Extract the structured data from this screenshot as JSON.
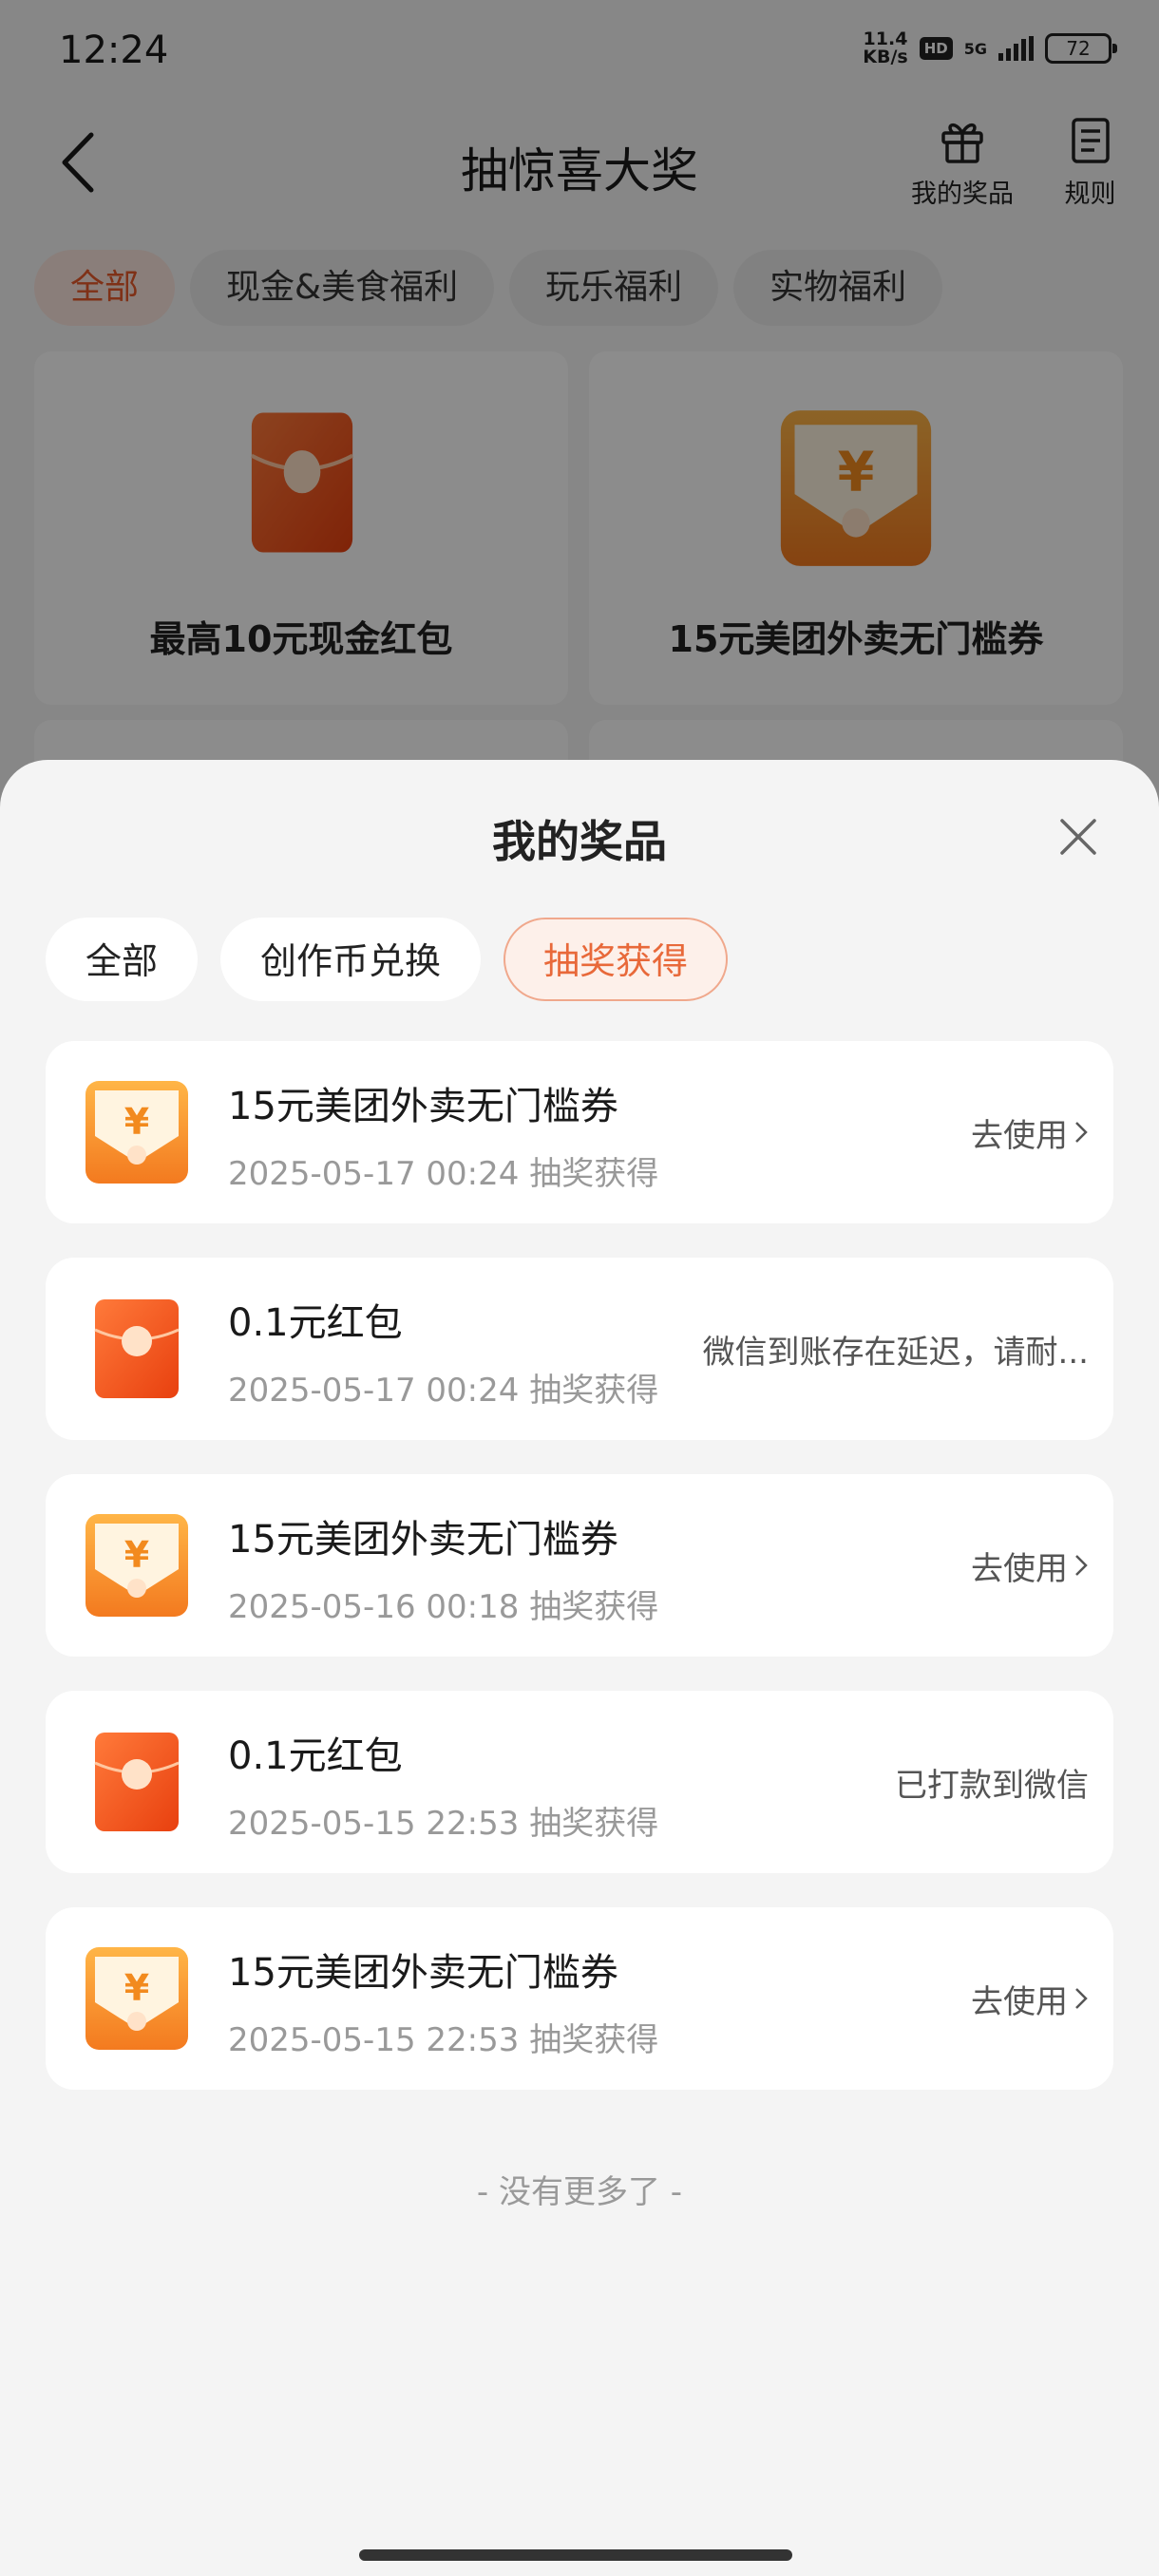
{
  "status_bar": {
    "time": "12:24",
    "net_speed_value": "11.4",
    "net_speed_unit": "KB/s",
    "hd": "HD",
    "signal_label": "5G",
    "battery": "72"
  },
  "header": {
    "title": "抽惊喜大奖",
    "my_prizes_label": "我的奖品",
    "rules_label": "规则"
  },
  "category_tabs": [
    {
      "label": "全部",
      "active": true
    },
    {
      "label": "现金&美食福利",
      "active": false
    },
    {
      "label": "玩乐福利",
      "active": false
    },
    {
      "label": "实物福利",
      "active": false
    }
  ],
  "background_cards": [
    {
      "title": "最高10元现金红包",
      "icon": "red-envelope-icon"
    },
    {
      "title": "15元美团外卖无门槛券",
      "icon": "coupon-envelope-icon"
    }
  ],
  "sheet": {
    "title": "我的奖品",
    "filter_tabs": [
      {
        "label": "全部",
        "active": false
      },
      {
        "label": "创作币兑换",
        "active": false
      },
      {
        "label": "抽奖获得",
        "active": true
      }
    ],
    "items": [
      {
        "name": "15元美团外卖无门槛券",
        "date": "2025-05-17 00:24 抽奖获得",
        "status": "去使用",
        "icon": "coupon-envelope-icon",
        "actionable": true
      },
      {
        "name": "0.1元红包",
        "date": "2025-05-17 00:24 抽奖获得",
        "status": "微信到账存在延迟，请耐...",
        "icon": "red-envelope-icon",
        "actionable": false
      },
      {
        "name": "15元美团外卖无门槛券",
        "date": "2025-05-16 00:18 抽奖获得",
        "status": "去使用",
        "icon": "coupon-envelope-icon",
        "actionable": true
      },
      {
        "name": "0.1元红包",
        "date": "2025-05-15 22:53 抽奖获得",
        "status": "已打款到微信",
        "icon": "red-envelope-icon",
        "actionable": false
      },
      {
        "name": "15元美团外卖无门槛券",
        "date": "2025-05-15 22:53 抽奖获得",
        "status": "去使用",
        "icon": "coupon-envelope-icon",
        "actionable": true
      }
    ],
    "footer_text": "- 没有更多了 -"
  },
  "colors": {
    "accent": "#e8693a",
    "envelope_red": "#f0541e",
    "coupon_orange": "#f7a43a"
  }
}
